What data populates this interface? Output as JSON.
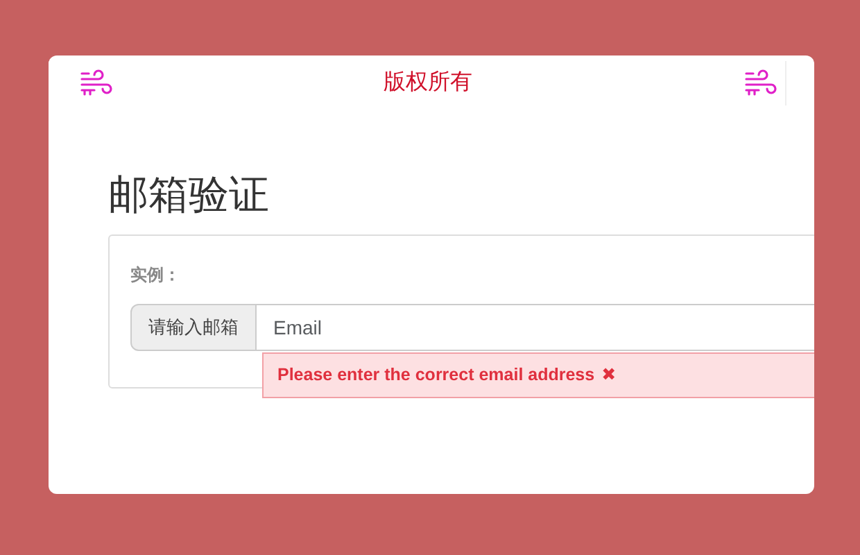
{
  "header": {
    "title": "版权所有"
  },
  "heading": "邮箱验证",
  "example_label": "实例：",
  "email_group": {
    "addon": "请输入邮箱",
    "placeholder": "Email"
  },
  "error": {
    "message": "Please enter the correct email address",
    "close": "✖"
  }
}
